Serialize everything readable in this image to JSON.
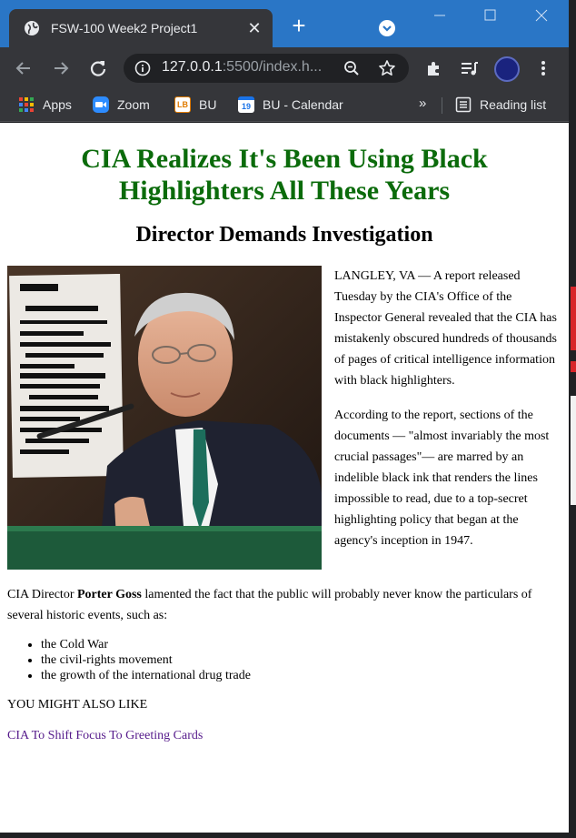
{
  "browser": {
    "tab_title": "FSW-100 Week2 Project1",
    "url_host": "127.0.0.1",
    "url_rest": ":5500/index.h...",
    "bookmarks": [
      {
        "label": "Apps"
      },
      {
        "label": "Zoom"
      },
      {
        "label": "BU",
        "icon_text": "LB"
      },
      {
        "label": "BU - Calendar",
        "icon_text": "19"
      }
    ],
    "overflow": "»",
    "reading_list": "Reading list",
    "colors": {
      "titlebar": "#2a76c6",
      "toolbar": "#35363a"
    }
  },
  "article": {
    "headline": "CIA Realizes It's Been Using Black Highlighters All These Years",
    "subheadline": "Director Demands Investigation",
    "photo_alt": "CIA Director Porter Goss at a hearing",
    "paragraph1": "LANGLEY, VA — A report released Tuesday by the CIA's Office of the Inspector General revealed that the CIA has mistakenly obscured hundreds of thousands of pages of critical intelligence information with black highlighters.",
    "paragraph2": "According to the report, sections of the documents — \"almost invariably the most crucial passages\"— are marred by an indelible black ink that renders the lines impossible to read, due to a top-secret highlighting policy that began at the agency's inception in 1947.",
    "paragraph3_before": "CIA Director ",
    "paragraph3_bold": "Porter Goss",
    "paragraph3_after": " lamented the fact that the public will probably never know the particulars of several historic events, such as:",
    "events": [
      "the Cold War",
      "the civil-rights movement",
      "the growth of the international drug trade"
    ],
    "also_like": "YOU MIGHT ALSO LIKE",
    "related_link": "CIA To Shift Focus To Greeting Cards",
    "colors": {
      "headline": "#0b6b0b",
      "link_visited": "#551a8b"
    }
  }
}
